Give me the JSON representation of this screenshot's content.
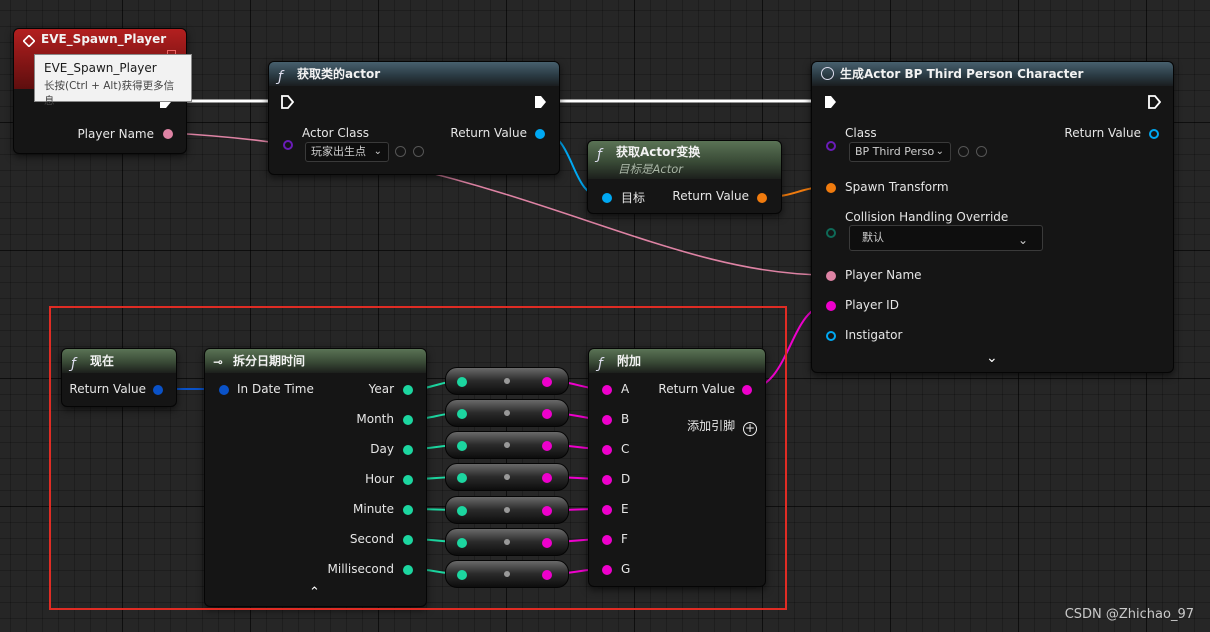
{
  "nodes": {
    "event": {
      "title": "EVE_Spawn_Player",
      "pins": {
        "player_name": "Player Name"
      },
      "tooltip": {
        "title": "EVE_Spawn_Player",
        "hint": "长按(Ctrl + Alt)获得更多信息"
      }
    },
    "get_actor_of_class": {
      "title": "获取类的actor",
      "pins": {
        "actor_class": "Actor Class",
        "return_value": "Return Value"
      },
      "class_dropdown": "玩家出生点"
    },
    "get_actor_transform": {
      "title": "获取Actor变换",
      "subtitle": "目标是Actor",
      "pins": {
        "target": "目标",
        "return_value": "Return Value"
      }
    },
    "spawn_actor": {
      "title": "生成Actor BP Third Person Character",
      "pins": {
        "class": "Class",
        "return_value": "Return Value",
        "spawn_transform": "Spawn Transform",
        "collision": "Collision Handling Override",
        "player_name": "Player Name",
        "player_id": "Player ID",
        "instigator": "Instigator"
      },
      "class_dropdown": "BP Third Perso",
      "collision_dropdown": "默认"
    },
    "now": {
      "title": "现在",
      "pins": {
        "return_value": "Return Value"
      }
    },
    "break_datetime": {
      "title": "拆分日期时间",
      "pins": {
        "in_date_time": "In Date Time"
      },
      "outputs": [
        "Year",
        "Month",
        "Day",
        "Hour",
        "Minute",
        "Second",
        "Millisecond"
      ]
    },
    "append": {
      "title": "附加",
      "inputs": [
        "A",
        "B",
        "C",
        "D",
        "E",
        "F",
        "G"
      ],
      "pins": {
        "return_value": "Return Value"
      },
      "add_pin": "添加引脚"
    }
  },
  "watermark": "CSDN @Zhichao_97",
  "colors": {
    "string_pin": "#ee00cc",
    "int_pin": "#1cd6a0",
    "struct_datetime_pin": "#0a52c8",
    "object_pin": "#00a8f2",
    "transform_pin": "#f07b0e",
    "class_pin": "#6a1cb8",
    "name_pin": "#de83a4",
    "selection": "#e02c24"
  },
  "icons": {
    "function": "function-icon",
    "event": "event-diamond-icon",
    "spawn": "spawn-icon"
  }
}
